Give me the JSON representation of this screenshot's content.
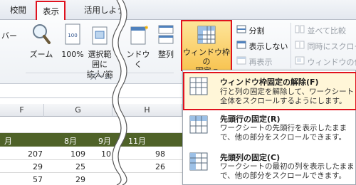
{
  "tabs": [
    {
      "label": "校閲",
      "active": false
    },
    {
      "label": "表示",
      "active": true
    },
    {
      "label": "活用しよう",
      "active": false
    }
  ],
  "ribbon": {
    "partial_left": "バー",
    "zoom_label": "ズーム",
    "hundred_label": "100%",
    "zoom_selection_label_line1": "選択範囲に",
    "zoom_selection_label_line2": "拡大/縮",
    "new_window_partial": "ンドウ",
    "new_window_partial2": "く",
    "arrange_label": "整列",
    "freeze_label_line1": "ウィンドウ枠の",
    "freeze_label_line2": "固定",
    "split_label": "分割",
    "hide_label": "表示しない",
    "unhide_label": "再表示",
    "side_by_side_label": "並べて比較",
    "sync_scroll_label": "同時にスクロー",
    "reset_position_label": "ウィンドウの位",
    "group_zoom_label": "ズーム"
  },
  "menu": {
    "items": [
      {
        "title": "ウィンドウ枠固定の解除(F)",
        "desc": "行と列の固定を解除して、ワークシート全体をスクロールするようにします。"
      },
      {
        "title": "先頭行の固定(R)",
        "desc": "ワークシートの先頭行を表示したままで、他の部分をスクロールできます。"
      },
      {
        "title": "先頭列の固定(C)",
        "desc": "ワークシートの最初の列を表示したままで、他の部分をスクロールできます。"
      }
    ]
  },
  "sheet": {
    "columns": [
      "F",
      "G",
      "H"
    ],
    "months": [
      "月",
      "8月",
      "9月",
      "11月"
    ],
    "rows": [
      [
        "207",
        "109",
        "10",
        "98"
      ],
      [
        "29",
        "25",
        "",
        "26"
      ],
      [
        "57",
        "29",
        "",
        ""
      ]
    ]
  },
  "colors": {
    "accent": "#e0121e",
    "header_fill": "#4f6228",
    "freeze_button": "#f8c451"
  }
}
